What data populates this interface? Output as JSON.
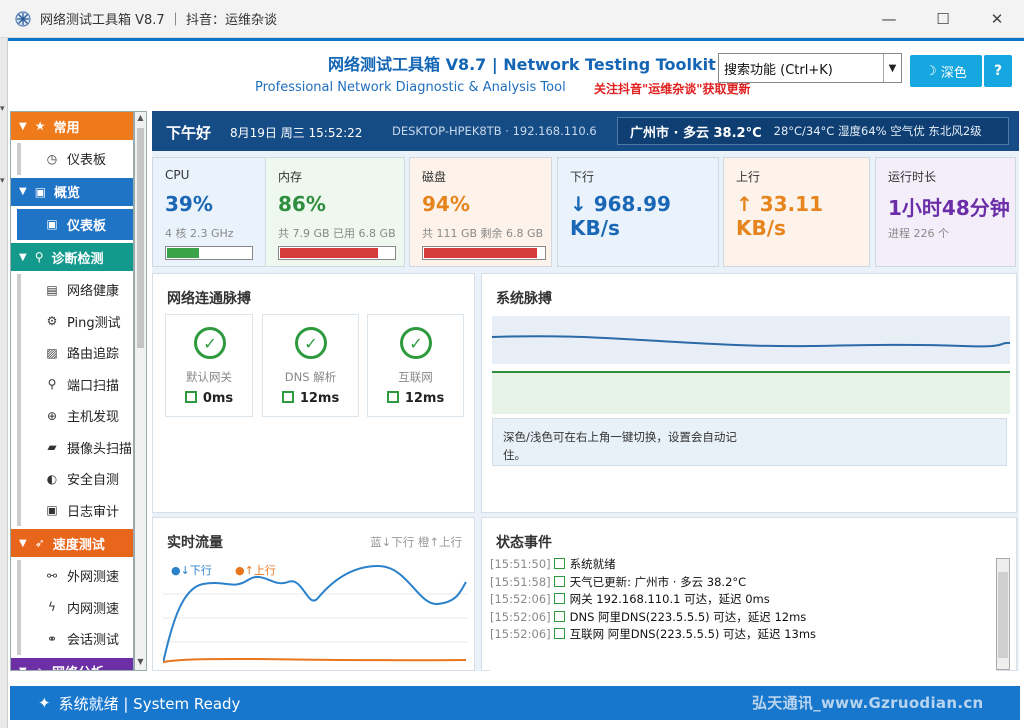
{
  "window": {
    "title": "网络测试工具箱 V8.7 ｜ 抖音：运维杂谈",
    "minimize": "—",
    "maximize": "☐",
    "close": "✕"
  },
  "header": {
    "title": "网络测试工具箱 V8.7 | Network Testing Toolkit",
    "subtitle": "Professional Network Diagnostic & Analysis Tool",
    "follow": "关注抖音\"运维杂谈\"获取更新",
    "search_value": "搜索功能 (Ctrl+K)",
    "theme_label": "深色",
    "help_label": "?"
  },
  "sidebar": {
    "cat_common": "常用",
    "item_dashboard_1": "仪表板",
    "cat_overview": "概览",
    "item_dashboard_2": "仪表板",
    "cat_diag": "诊断检测",
    "item_net_health": "网络健康",
    "item_ping": "Ping测试",
    "item_route": "路由追踪",
    "item_port": "端口扫描",
    "item_host": "主机发现",
    "item_camera": "摄像头扫描",
    "item_security": "安全自测",
    "item_log": "日志审计",
    "cat_speed": "速度测试",
    "item_ext_speed": "外网测速",
    "item_int_speed": "内网测速",
    "item_session": "会话测试",
    "cat_analysis": "网络分析"
  },
  "topbar": {
    "greeting": "下午好",
    "datetime": "8月19日 周三 15:52:22",
    "host": "DESKTOP-HPEK8TB · 192.168.110.6",
    "city_weather": "广州市 · 多云 38.2°C",
    "weather_meta": "28°C/34°C 湿度64% 空气优 东北风2级"
  },
  "cards": {
    "cpu": {
      "label": "CPU",
      "value": "39%",
      "sub": "4 核  2.3 GHz",
      "level": 0.39,
      "color": "#1a67b5",
      "bar": "#3aa34a"
    },
    "mem": {
      "label": "内存",
      "value": "86%",
      "sub": "共 7.9 GB  已用 6.8 GB",
      "level": 0.86,
      "color": "#2f8f3f",
      "bar": "#d63b3b"
    },
    "disk": {
      "label": "磁盘",
      "value": "94%",
      "sub": "共 111 GB  剩余 6.8 GB",
      "level": 0.94,
      "color": "#e6851e",
      "bar": "#d63b3b"
    },
    "down": {
      "label": "下行",
      "value": "↓ 968.99 KB/s",
      "color": "#1a67b5"
    },
    "up": {
      "label": "上行",
      "value": "↑ 33.11 KB/s",
      "color": "#e6851e"
    },
    "uptime": {
      "label": "运行时长",
      "value": "1小时48分钟",
      "sub": "进程 226 个",
      "color": "#6b2ea8"
    }
  },
  "pulse": {
    "title": "网络连通脉搏",
    "checks": [
      {
        "name": "默认网关",
        "ms": "0ms"
      },
      {
        "name": "DNS 解析",
        "ms": "12ms"
      },
      {
        "name": "互联网",
        "ms": "12ms"
      }
    ]
  },
  "system": {
    "title": "系统脉搏",
    "tip": "深色/浅色可在右上角一键切换，设置会自动记住。"
  },
  "traffic": {
    "title": "实时流量",
    "legend_right": "蓝↓下行  橙↑上行",
    "series_down": "↓下行",
    "series_up": "↑上行"
  },
  "events": {
    "title": "状态事件",
    "items": [
      {
        "ts": "[15:51:50]",
        "text": "系统就绪"
      },
      {
        "ts": "[15:51:58]",
        "text": "天气已更新: 广州市 · 多云 38.2°C"
      },
      {
        "ts": "[15:52:06]",
        "text": "网关 192.168.110.1 可达，延迟 0ms"
      },
      {
        "ts": "[15:52:06]",
        "text": "DNS 阿里DNS(223.5.5.5) 可达，延迟 12ms"
      },
      {
        "ts": "[15:52:06]",
        "text": "互联网 阿里DNS(223.5.5.5) 可达，延迟 13ms"
      }
    ]
  },
  "status": {
    "text": "系统就绪 | System Ready",
    "watermark": "弘天通讯_www.Gzruodian.cn"
  }
}
